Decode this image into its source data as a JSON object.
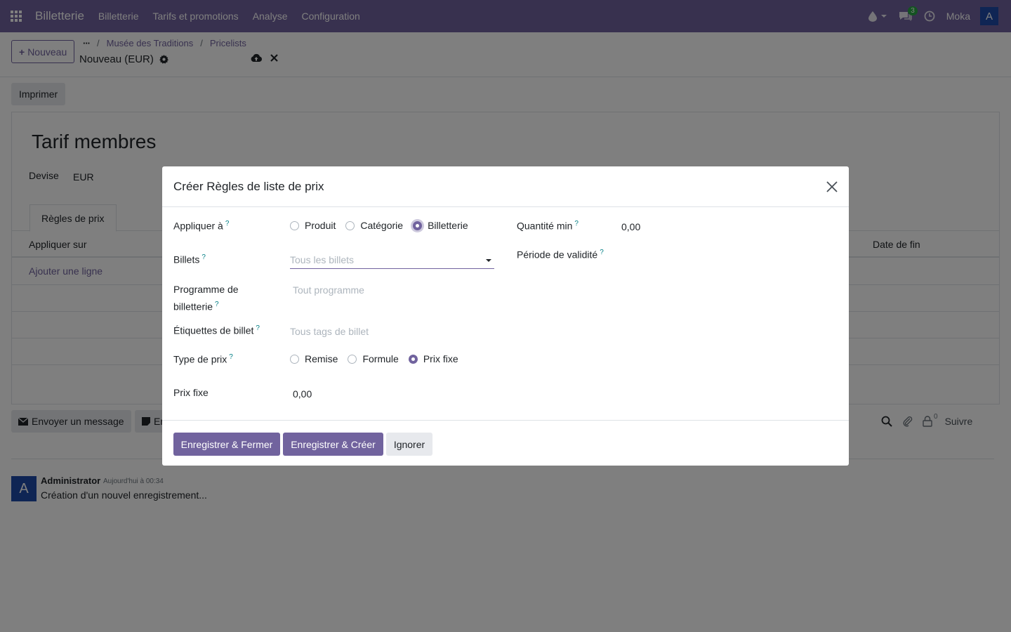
{
  "navbar": {
    "brand": "Billetterie",
    "menu": [
      "Billetterie",
      "Tarifs et promotions",
      "Analyse",
      "Configuration"
    ],
    "messages_count": "3",
    "company": "Moka",
    "user_initial": "A"
  },
  "control_panel": {
    "new_button": "Nouveau",
    "breadcrumb": [
      "Musée des Traditions",
      "Pricelists"
    ],
    "record_name": "Nouveau (EUR)"
  },
  "form": {
    "print_button": "Imprimer",
    "title": "Tarif membres",
    "currency_label": "Devise",
    "currency_value": "EUR",
    "tab_label": "Règles de prix",
    "columns": [
      "Appliquer sur",
      "Date de fin"
    ],
    "add_line": "Ajouter une ligne"
  },
  "chatter": {
    "send_message": "Envoyer un message",
    "log_note_partial": "En",
    "followers_count": "0",
    "follow": "Suivre",
    "message": {
      "author": "Administrator",
      "date": "Aujourd'hui à 00:34",
      "initial": "A",
      "body": "Création d'un nouvel enregistrement..."
    }
  },
  "modal": {
    "title": "Créer Règles de liste de prix",
    "apply_to": {
      "label": "Appliquer à",
      "options": [
        "Produit",
        "Catégorie",
        "Billetterie"
      ],
      "selected": "Billetterie"
    },
    "tickets": {
      "label": "Billets",
      "placeholder": "Tous les billets"
    },
    "program": {
      "label": "Programme de billetterie",
      "placeholder": "Tout programme"
    },
    "tags": {
      "label": "Étiquettes de billet",
      "placeholder": "Tous tags de billet"
    },
    "price_type": {
      "label": "Type de prix",
      "options": [
        "Remise",
        "Formule",
        "Prix fixe"
      ],
      "selected": "Prix fixe"
    },
    "fixed_price": {
      "label": "Prix fixe",
      "value": "0,00"
    },
    "min_qty": {
      "label": "Quantité min",
      "value": "0,00"
    },
    "validity": {
      "label": "Période de validité"
    },
    "help_mark": "?",
    "buttons": {
      "save_close": "Enregistrer & Fermer",
      "save_new": "Enregistrer & Créer",
      "discard": "Ignorer"
    }
  },
  "colors": {
    "brand": "#71639e",
    "help": "#017e84",
    "avatar": "#1f4aa8",
    "badge": "#28a745"
  }
}
